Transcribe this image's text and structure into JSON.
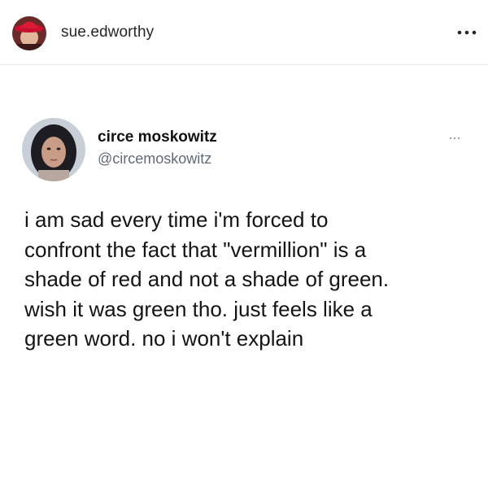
{
  "post": {
    "username": "sue.edworthy",
    "avatar_icon": "profile-avatar-red-hat",
    "more_icon": "more-horizontal-icon"
  },
  "tweet": {
    "display_name": "circe moskowitz",
    "handle": "@circemoskowitz",
    "avatar_icon": "profile-avatar-portrait",
    "more_icon": "more-horizontal-icon",
    "text_lines": [
      "i am sad every time i'm forced to",
      "confront the fact that \"vermillion\" is a",
      "shade of red and not a shade of green.",
      "wish it was green tho. just feels like a",
      "green word. no i won't explain"
    ]
  },
  "colors": {
    "background": "#ffffff",
    "divider": "#e6e6e6",
    "text_primary": "#141414",
    "text_secondary": "#5f6b77",
    "avatar_hat": "#c8102e"
  }
}
